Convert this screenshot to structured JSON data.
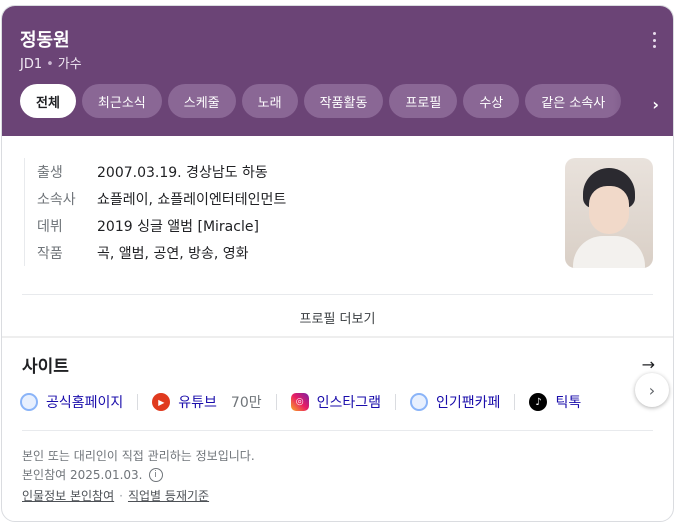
{
  "header": {
    "name": "정동원",
    "group": "JD1",
    "role": "가수",
    "tabs": [
      "전체",
      "최근소식",
      "스케줄",
      "노래",
      "작품활동",
      "프로필",
      "수상",
      "같은 소속사"
    ]
  },
  "profile": {
    "rows": [
      {
        "label": "출생",
        "value": "2007.03.19. 경상남도 하동"
      },
      {
        "label": "소속사",
        "value": "쇼플레이, 쇼플레이엔터테인먼트"
      },
      {
        "label": "데뷔",
        "value": "2019 싱글 앨범 [Miracle]"
      },
      {
        "label": "작품",
        "value": "곡, 앨범, 공연, 방송, 영화"
      }
    ],
    "more_label": "프로필 더보기"
  },
  "sites": {
    "title": "사이트",
    "items": [
      {
        "label": "공식홈페이지",
        "icon": "globe-icon"
      },
      {
        "label": "유튜브",
        "count": "70만",
        "icon": "youtube-icon"
      },
      {
        "label": "인스타그램",
        "icon": "instagram-icon"
      },
      {
        "label": "인기팬카페",
        "icon": "globe-icon"
      },
      {
        "label": "틱톡",
        "icon": "tiktok-icon"
      }
    ]
  },
  "footer": {
    "notice": "본인 또는 대리인이 직접 관리하는 정보입니다.",
    "date": "본인참여 2025.01.03.",
    "link1": "인물정보 본인참여",
    "link2": "직업별 등재기준"
  },
  "colors": {
    "header_bg": "#6b4476",
    "link": "#1a0dab"
  }
}
